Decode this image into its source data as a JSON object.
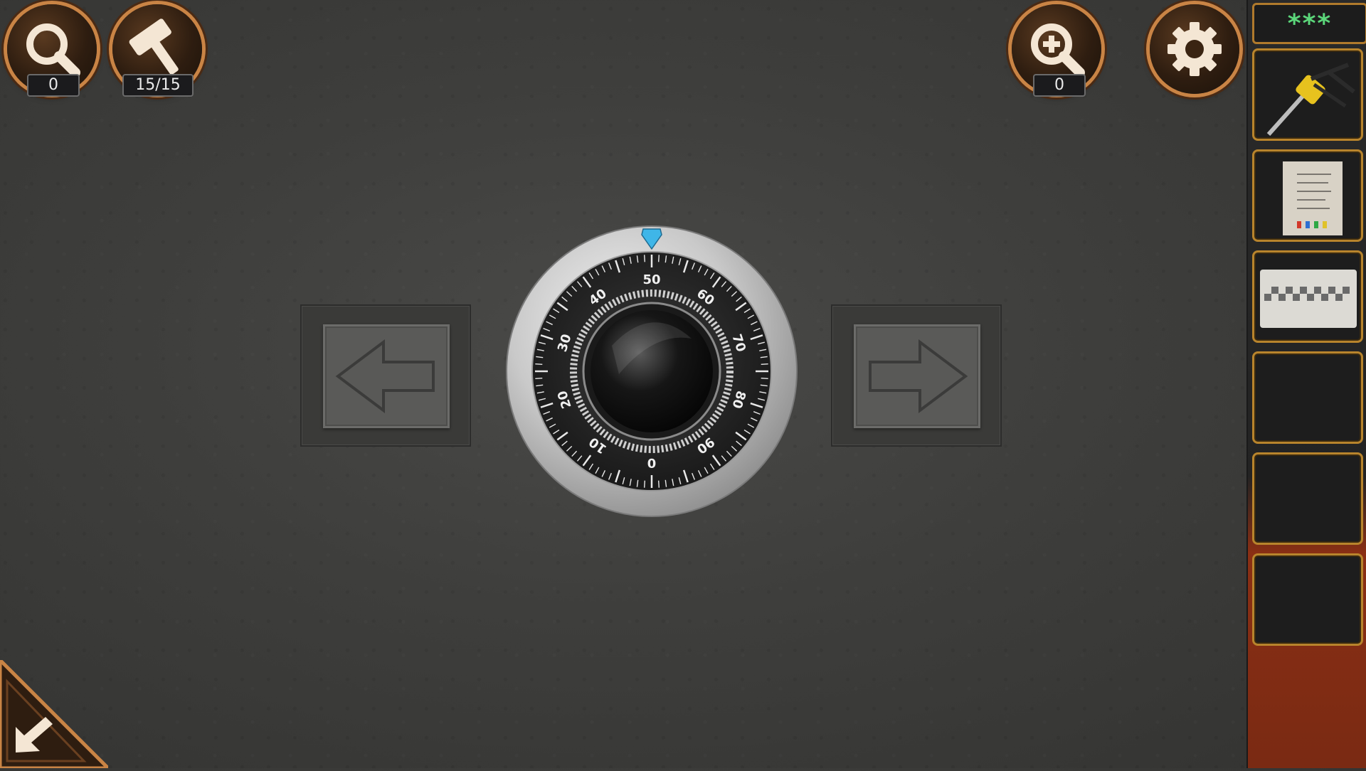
{
  "hud": {
    "hint_counter": "0",
    "hammer_counter": "15/15",
    "zoom_counter": "0"
  },
  "icons": {
    "hint": "magnifier-icon",
    "hammer": "hammer-icon",
    "zoom": "zoom-in-icon",
    "settings": "gear-icon",
    "back": "arrow-down-left-icon",
    "left": "arrow-left-icon",
    "right": "arrow-right-icon"
  },
  "dial": {
    "numbers": [
      "0",
      "10",
      "20",
      "30",
      "40",
      "50",
      "60",
      "70",
      "80",
      "90"
    ],
    "indicator_value": "50",
    "indicator_color": "#3fb6e8"
  },
  "inventory": {
    "header": "***",
    "slots": [
      {
        "item": "jackhammer"
      },
      {
        "item": "note-paper"
      },
      {
        "item": "pattern-tile"
      },
      {
        "item": ""
      },
      {
        "item": ""
      },
      {
        "item": ""
      }
    ]
  },
  "colors": {
    "accent_copper": "#c98445",
    "slot_border": "#b8842c",
    "header_text": "#5bd67a"
  }
}
